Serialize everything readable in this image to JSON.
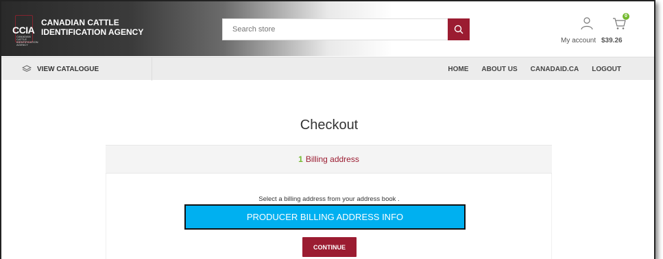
{
  "header": {
    "logo": {
      "mark_text": "CCIA",
      "small_text": "CANADIAN CATTLE IDENTIFICATION AGENCY",
      "line1": "CANADIAN CATTLE",
      "line2": "IDENTIFICATION AGENCY"
    },
    "search": {
      "placeholder": "Search store"
    },
    "account": {
      "label": "My account",
      "cart_total": "$39.26",
      "cart_count": "0"
    }
  },
  "nav": {
    "catalogue_label": "VIEW CATALOGUE",
    "links": [
      "HOME",
      "ABOUT US",
      "CANADAID.CA",
      "LOGOUT"
    ]
  },
  "main": {
    "title": "Checkout",
    "step": {
      "number": "1",
      "label": "Billing address"
    },
    "instruction": "Select a billing address from your address book .",
    "address_box": "PRODUCER BILLING ADDRESS INFO",
    "continue_label": "CONTINUE"
  },
  "colors": {
    "brand": "#9b1c31",
    "accent_green": "#73b92e",
    "address_box_bg": "#00b0f0"
  }
}
